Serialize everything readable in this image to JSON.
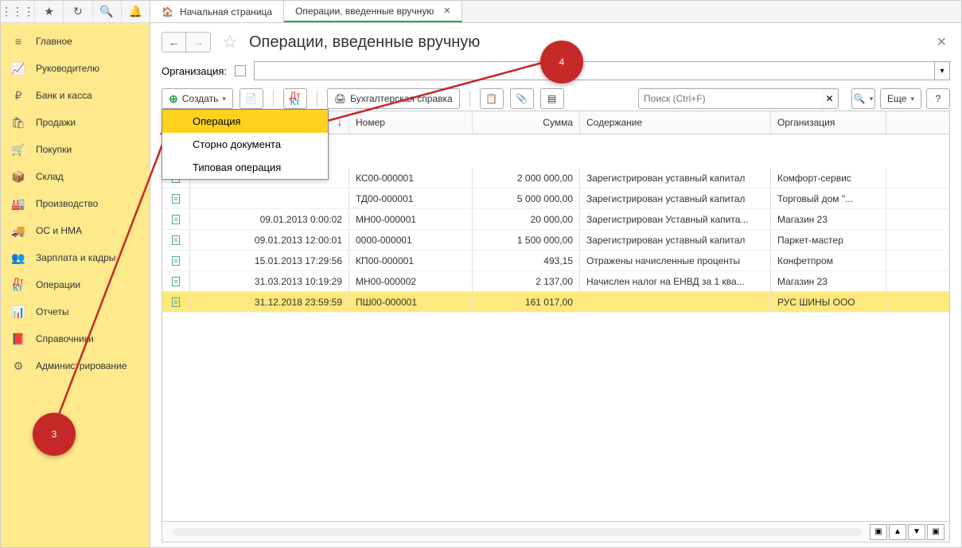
{
  "tabs": {
    "home": "Начальная страница",
    "active": "Операции, введенные вручную"
  },
  "pageTitle": "Операции, введенные вручную",
  "orgLabel": "Организация:",
  "toolbar": {
    "create": "Создать",
    "ref": "Бухгалтерская справка",
    "searchPlaceholder": "Поиск (Ctrl+F)",
    "more": "Еще"
  },
  "dropdown": {
    "i0": "Операция",
    "i1": "Сторно документа",
    "i2": "Типовая операция"
  },
  "headers": {
    "date": "↓",
    "num": "Номер",
    "sum": "Сумма",
    "desc": "Содержание",
    "org": "Организация"
  },
  "rows": [
    {
      "date": "",
      "num": "КС00-000001",
      "sum": "2 000 000,00",
      "desc": "Зарегистрирован уставный капитал",
      "org": "Комфорт-сервис"
    },
    {
      "date": "",
      "num": "ТД00-000001",
      "sum": "5 000 000,00",
      "desc": "Зарегистрирован уставный капитал",
      "org": "Торговый дом \"..."
    },
    {
      "date": "09.01.2013 0:00:02",
      "num": "МН00-000001",
      "sum": "20 000,00",
      "desc": "Зарегистрирован Уставный капита...",
      "org": "Магазин 23"
    },
    {
      "date": "09.01.2013 12:00:01",
      "num": "0000-000001",
      "sum": "1 500 000,00",
      "desc": "Зарегистрирован уставный капитал",
      "org": "Паркет-мастер"
    },
    {
      "date": "15.01.2013 17:29:56",
      "num": "КП00-000001",
      "sum": "493,15",
      "desc": "Отражены начисленные проценты",
      "org": "Конфетпром"
    },
    {
      "date": "31.03.2013 10:19:29",
      "num": "МН00-000002",
      "sum": "2 137,00",
      "desc": "Начислен налог на ЕНВД за 1 ква...",
      "org": "Магазин 23"
    },
    {
      "date": "31.12.2018 23:59:59",
      "num": "ПШ00-000001",
      "sum": "161 017,00",
      "desc": "",
      "org": "РУС ШИНЫ ООО"
    }
  ],
  "nav": {
    "n0": "Главное",
    "n1": "Руководителю",
    "n2": "Банк и касса",
    "n3": "Продажи",
    "n4": "Покупки",
    "n5": "Склад",
    "n6": "Производство",
    "n7": "ОС и НМА",
    "n8": "Зарплата и кадры",
    "n9": "Операции",
    "n10": "Отчеты",
    "n11": "Справочники",
    "n12": "Администрирование"
  },
  "callouts": {
    "b3": "3",
    "b4": "4"
  }
}
